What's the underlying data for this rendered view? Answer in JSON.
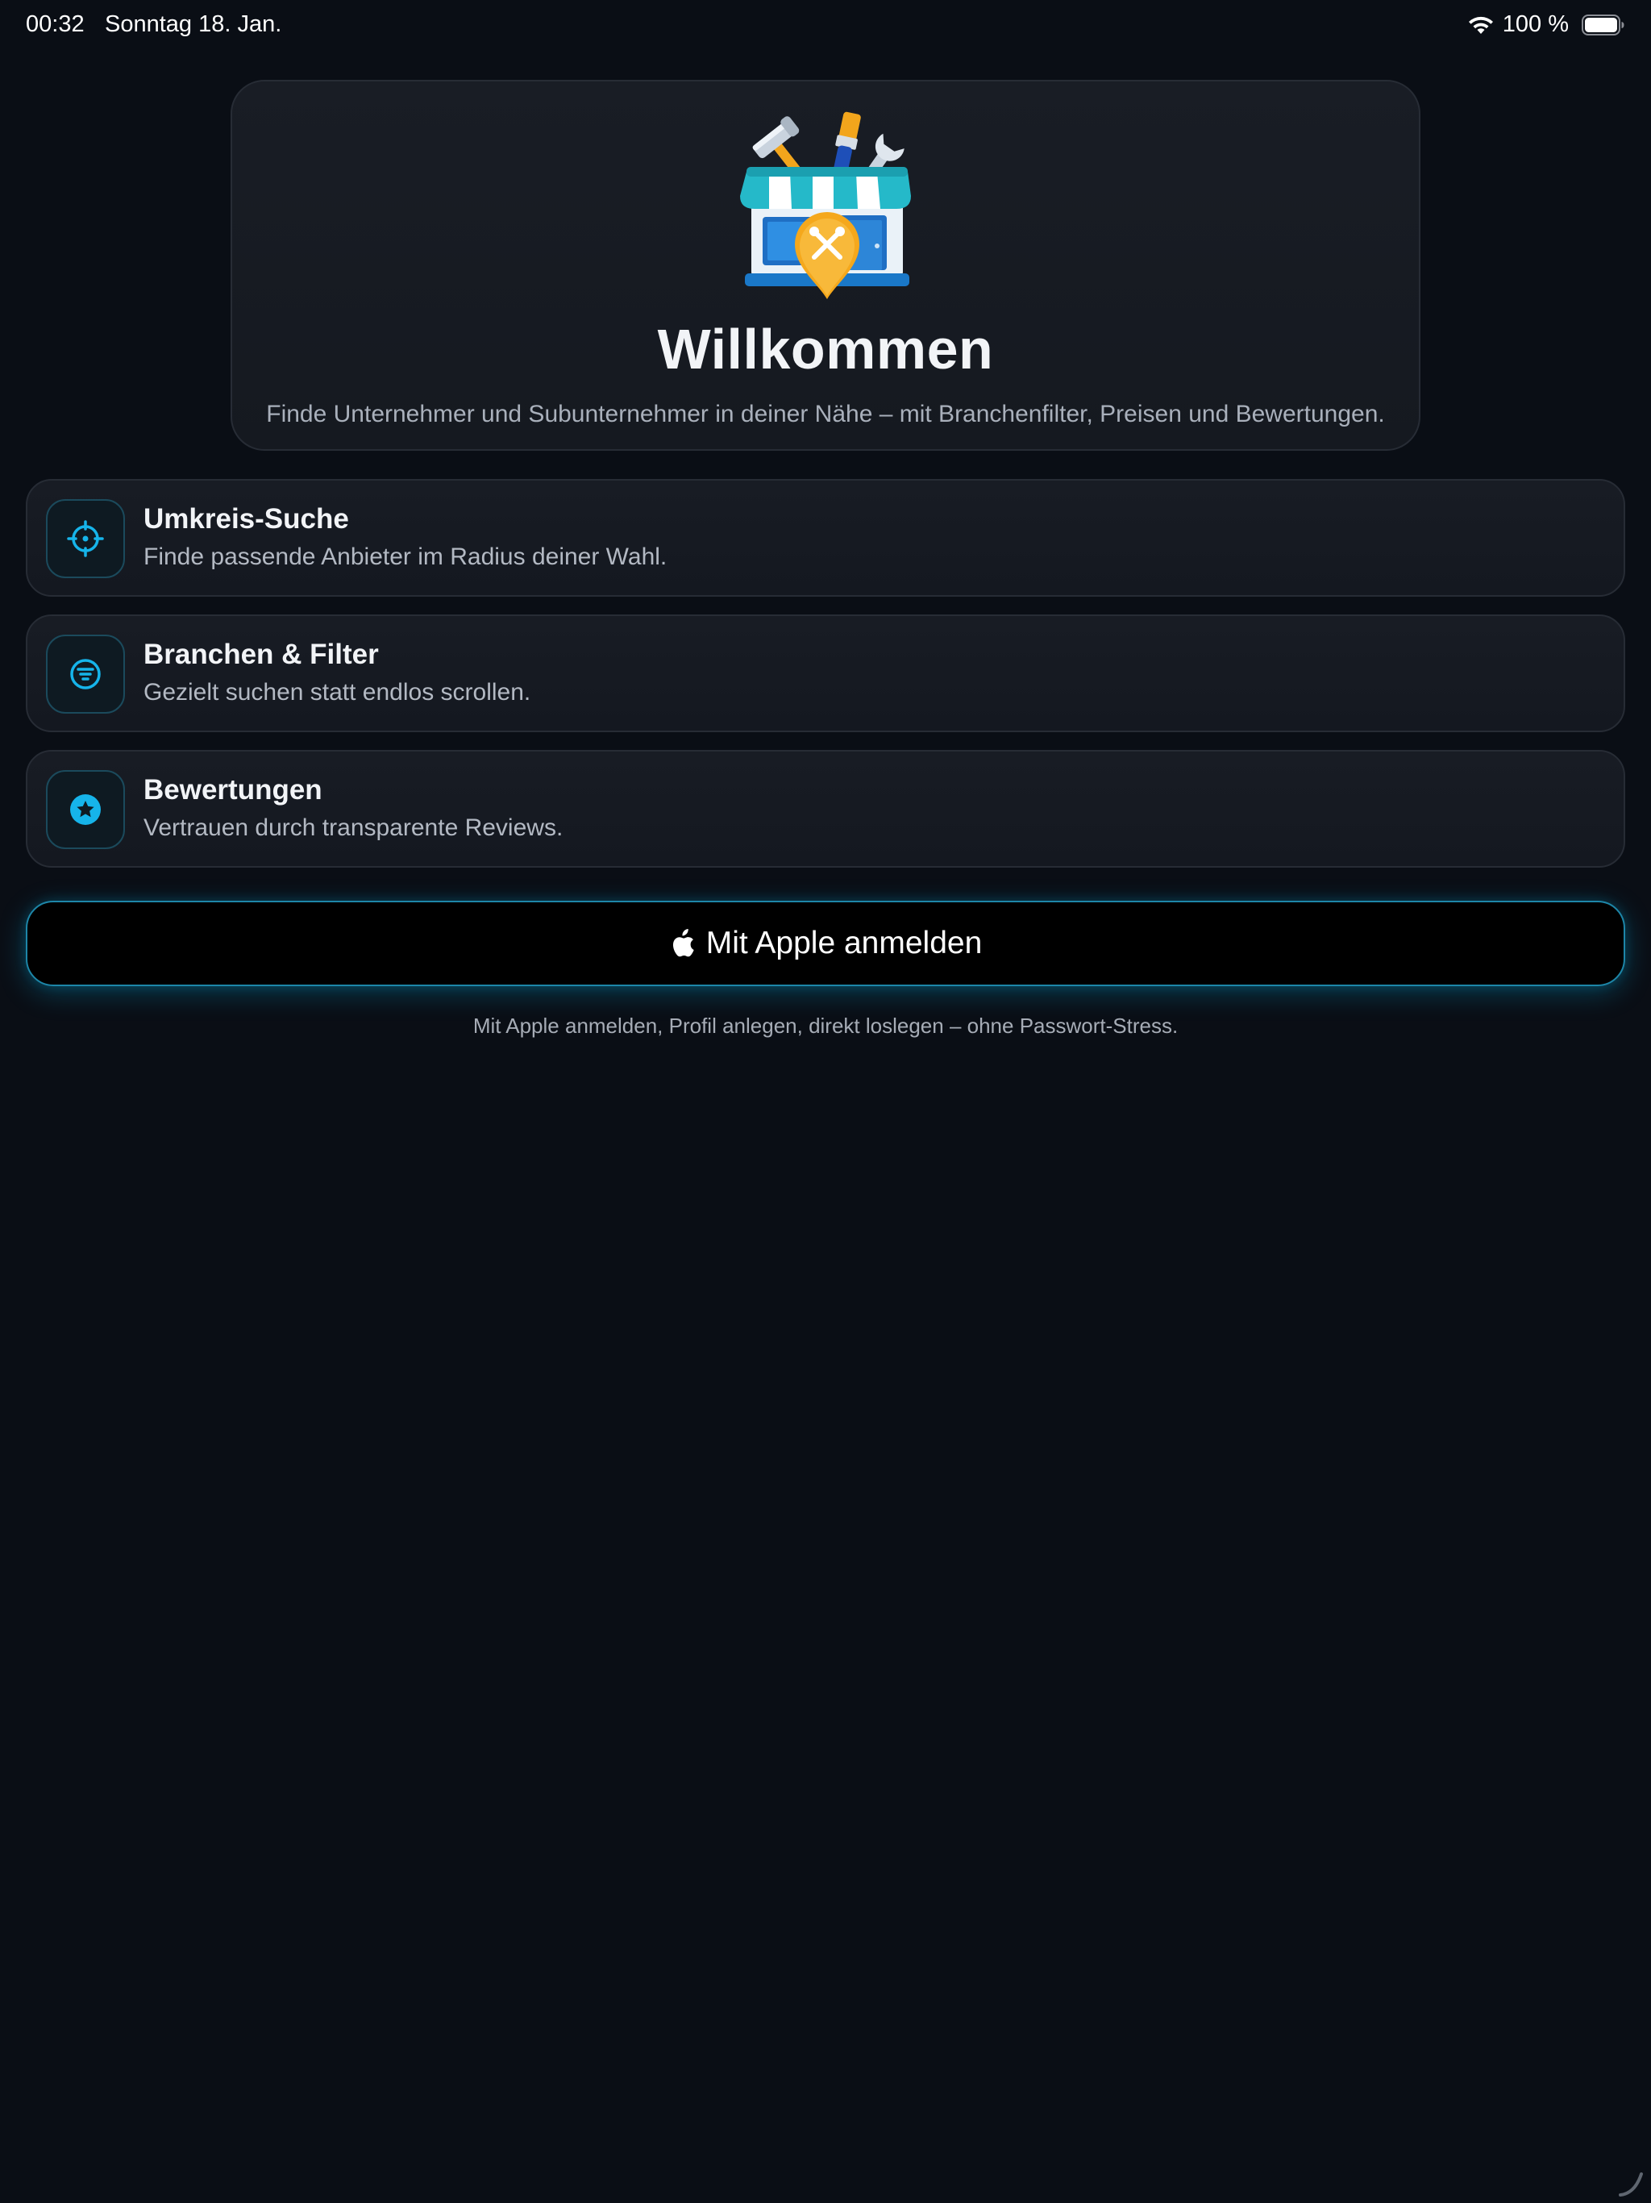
{
  "status_bar": {
    "time": "00:32",
    "date": "Sonntag 18. Jan.",
    "battery_text": "100 %",
    "icons": [
      "wifi-icon",
      "battery-icon"
    ]
  },
  "hero": {
    "illustration": "storefront-tools-icon",
    "title": "Willkommen",
    "subtitle": "Finde Unternehmer und Subunternehmer in deiner Nähe – mit Branchenfilter, Preisen und Bewertungen."
  },
  "features": [
    {
      "icon": "crosshair-icon",
      "title": "Umkreis-Suche",
      "description": "Finde passende Anbieter im Radius deiner Wahl."
    },
    {
      "icon": "filter-circle-icon",
      "title": "Branchen & Filter",
      "description": "Gezielt suchen statt endlos scrollen."
    },
    {
      "icon": "star-circle-icon",
      "title": "Bewertungen",
      "description": "Vertrauen durch transparente Reviews."
    }
  ],
  "sign_in": {
    "icon": "apple-logo-icon",
    "label": "Mit Apple anmelden"
  },
  "footnote": "Mit Apple anmelden, Profil anlegen, direkt loslegen – ohne Passwort-Stress.",
  "colors": {
    "background": "#0a0e15",
    "card": "#181c24",
    "accent": "#16b4ea",
    "button": "#000000"
  }
}
